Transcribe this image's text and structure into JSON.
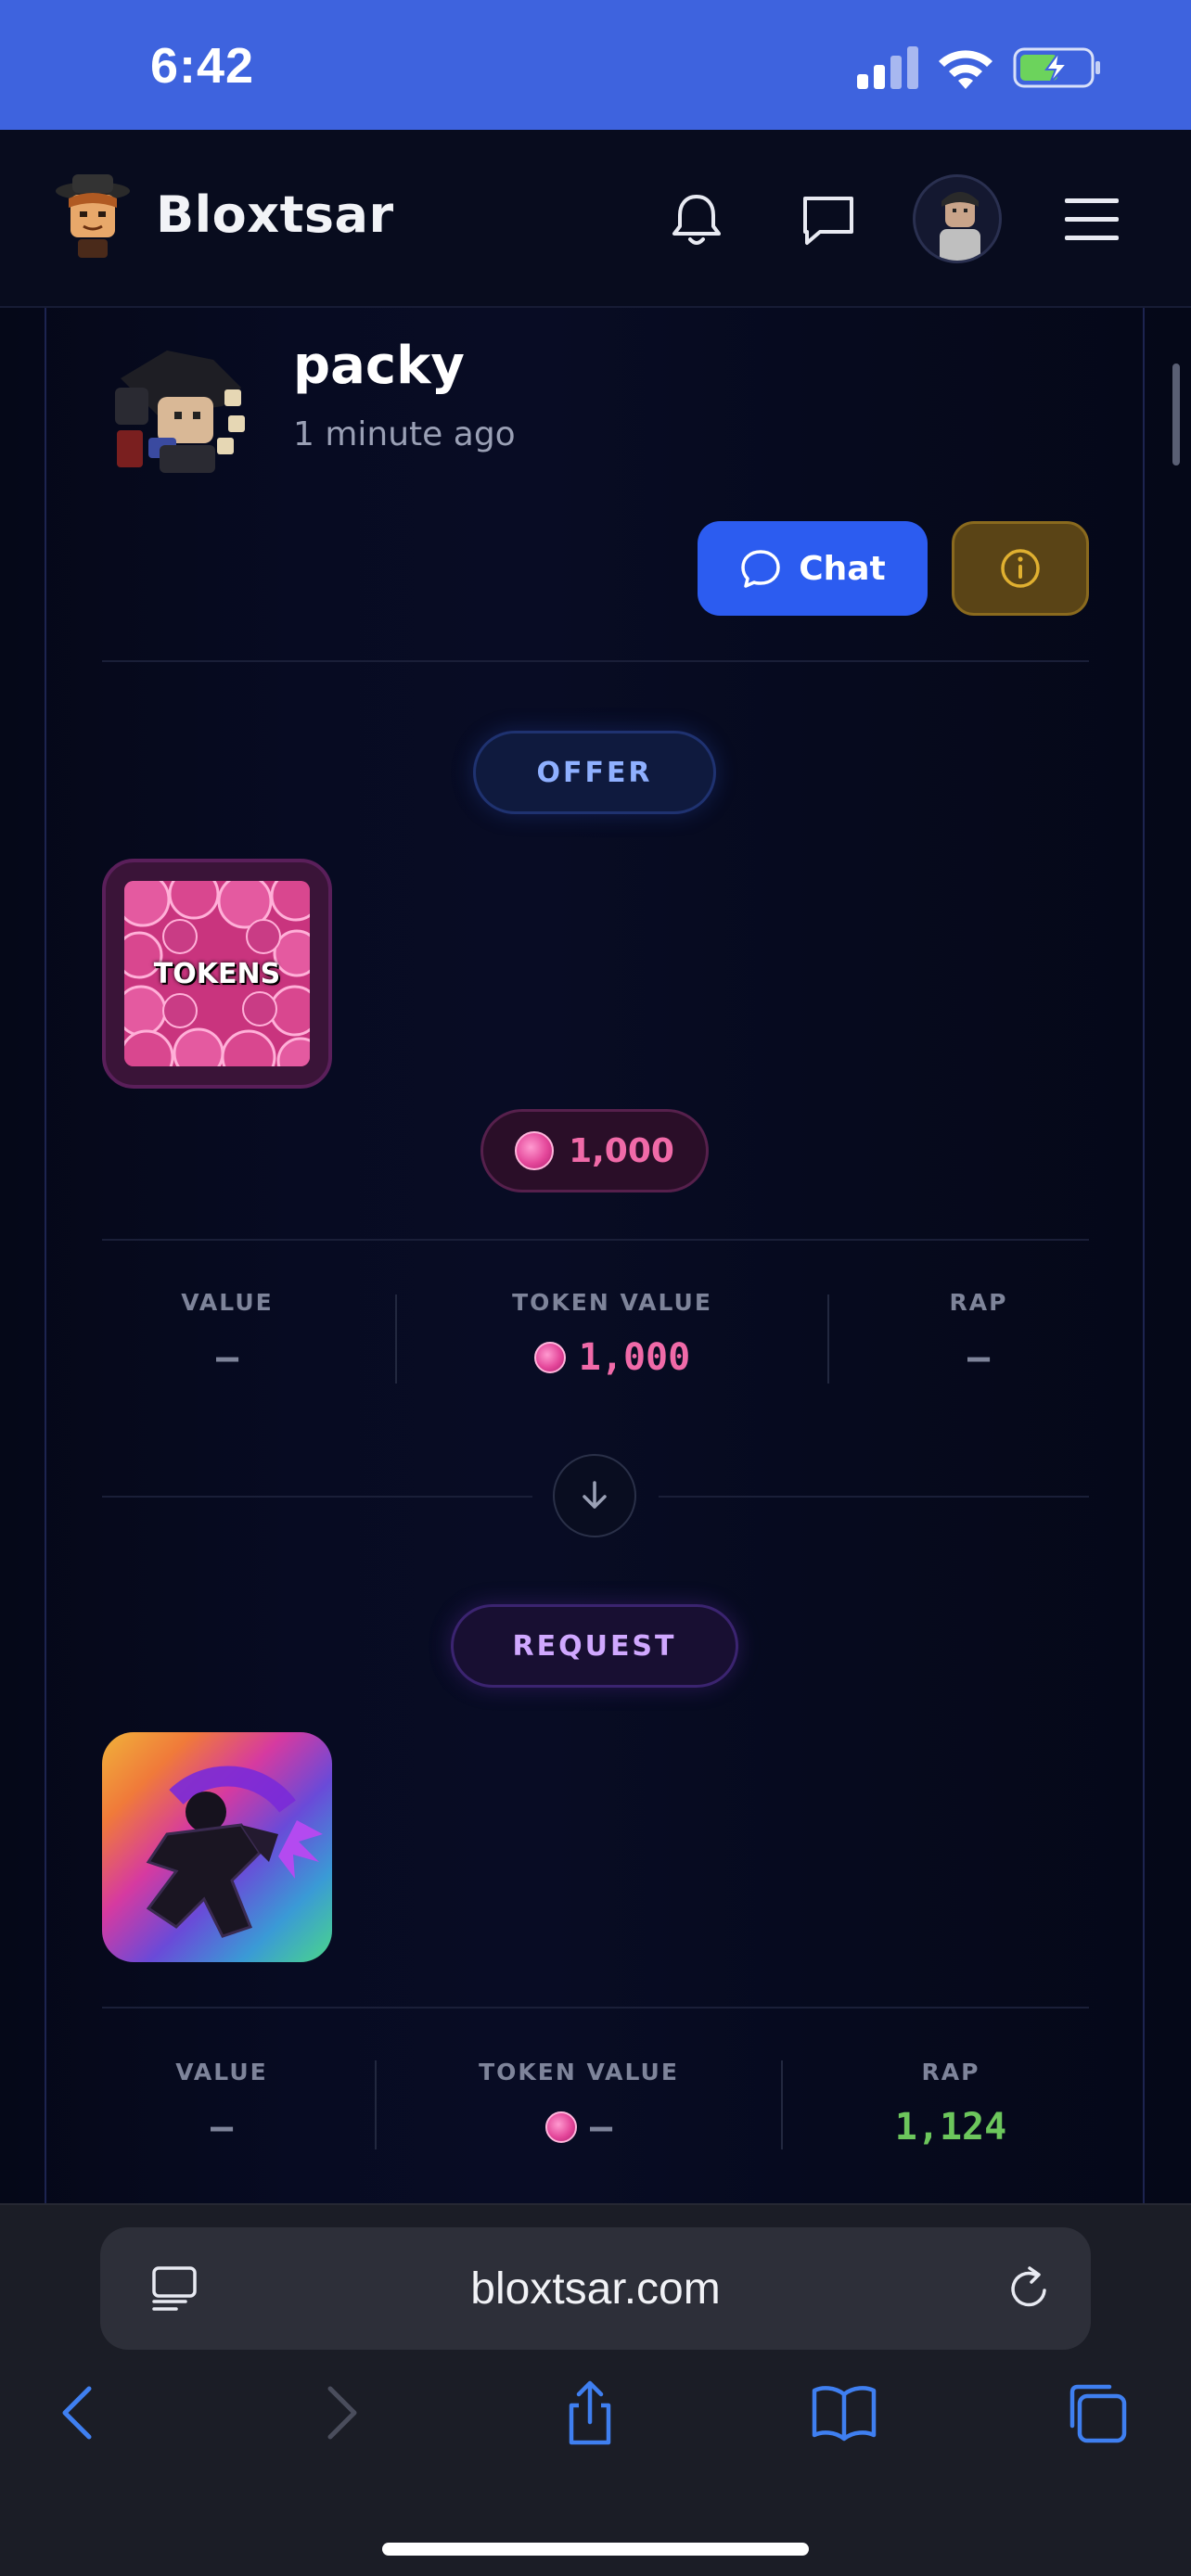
{
  "status_bar": {
    "time": "6:42"
  },
  "header": {
    "brand": "Bloxtsar"
  },
  "trade": {
    "username": "packy",
    "timestamp": "1 minute ago",
    "chat_label": "Chat"
  },
  "offer": {
    "section_label": "OFFER",
    "item_label": "TOKENS",
    "amount": "1,000",
    "stats": {
      "value_label": "VALUE",
      "value": "–",
      "token_value_label": "TOKEN VALUE",
      "token_value": "1,000",
      "rap_label": "RAP",
      "rap": "–"
    }
  },
  "request": {
    "section_label": "REQUEST",
    "stats": {
      "value_label": "VALUE",
      "value": "–",
      "token_value_label": "TOKEN VALUE",
      "token_value": "–",
      "rap_label": "RAP",
      "rap": "1,124"
    }
  },
  "browser": {
    "url": "bloxtsar.com"
  },
  "colors": {
    "accent_blue": "#2c5cf0",
    "token_pink": "#f06aa8",
    "rap_green": "#6cc65c",
    "info_gold": "#e0b030"
  },
  "icons": [
    "signal-icon",
    "wifi-icon",
    "battery-icon",
    "bell-icon",
    "message-icon",
    "menu-icon",
    "chat-bubble-icon",
    "info-icon",
    "arrow-down-icon",
    "tabs-icon",
    "reload-icon",
    "back-icon",
    "forward-icon",
    "share-icon",
    "bookmarks-icon",
    "tabs-overview-icon"
  ]
}
